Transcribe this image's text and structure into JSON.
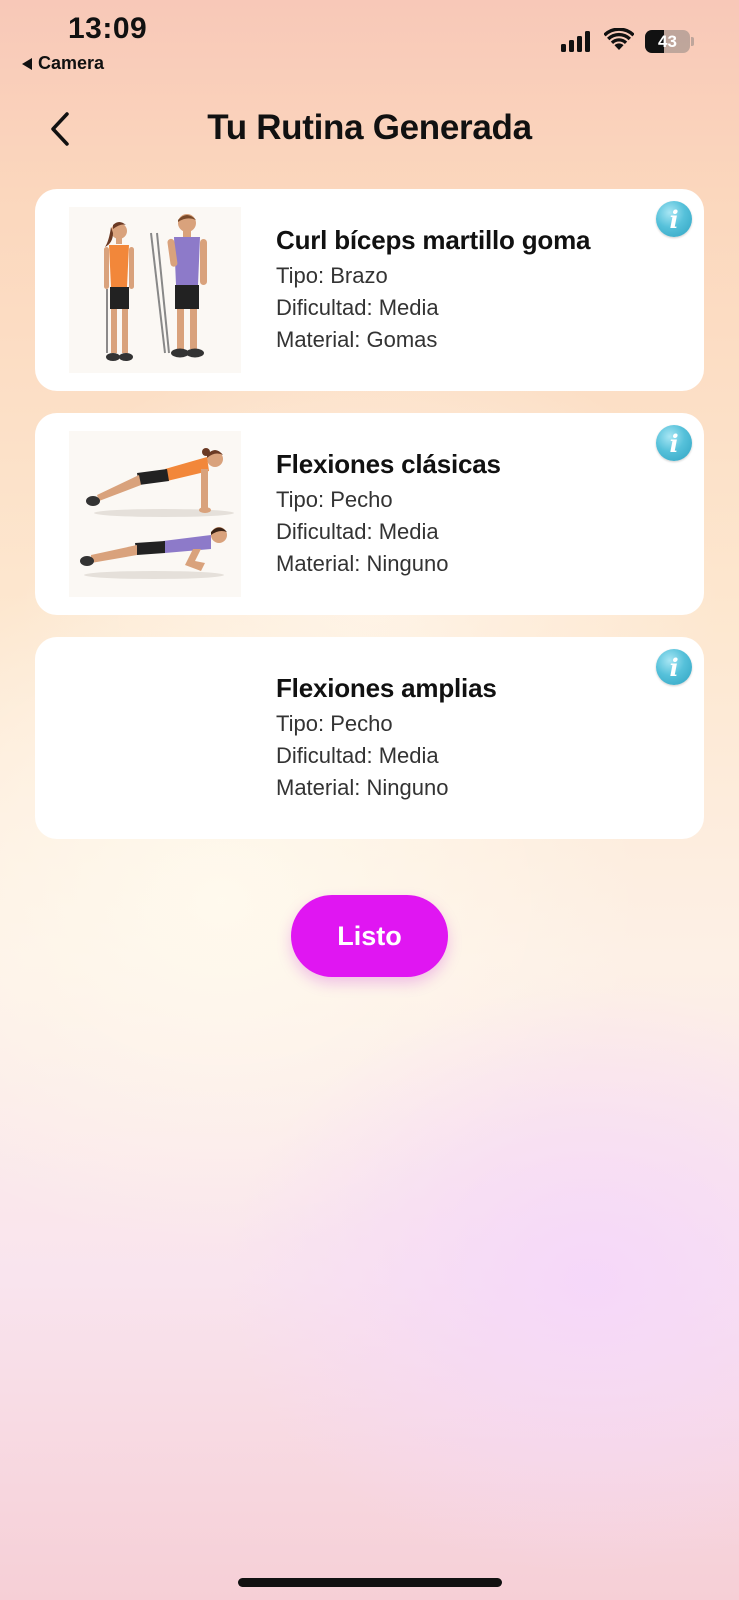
{
  "status_bar": {
    "time": "13:09",
    "back_app": "Camera",
    "battery": "43"
  },
  "header": {
    "title": "Tu Rutina Generada",
    "back_icon": "chevron-left-icon"
  },
  "exercises": [
    {
      "name": "Curl bíceps martillo goma",
      "type": "Tipo: Brazo",
      "difficulty": "Dificultad: Media",
      "material": "Material: Gomas",
      "info_icon": "info-icon"
    },
    {
      "name": "Flexiones clásicas",
      "type": "Tipo: Pecho",
      "difficulty": "Dificultad: Media",
      "material": "Material: Ninguno",
      "info_icon": "info-icon"
    },
    {
      "name": "Flexiones amplias",
      "type": "Tipo: Pecho",
      "difficulty": "Dificultad: Media",
      "material": "Material: Ninguno",
      "info_icon": "info-icon"
    }
  ],
  "actions": {
    "done_label": "Listo"
  },
  "colors": {
    "accent": "#e016f2",
    "info": "#56c1da"
  }
}
